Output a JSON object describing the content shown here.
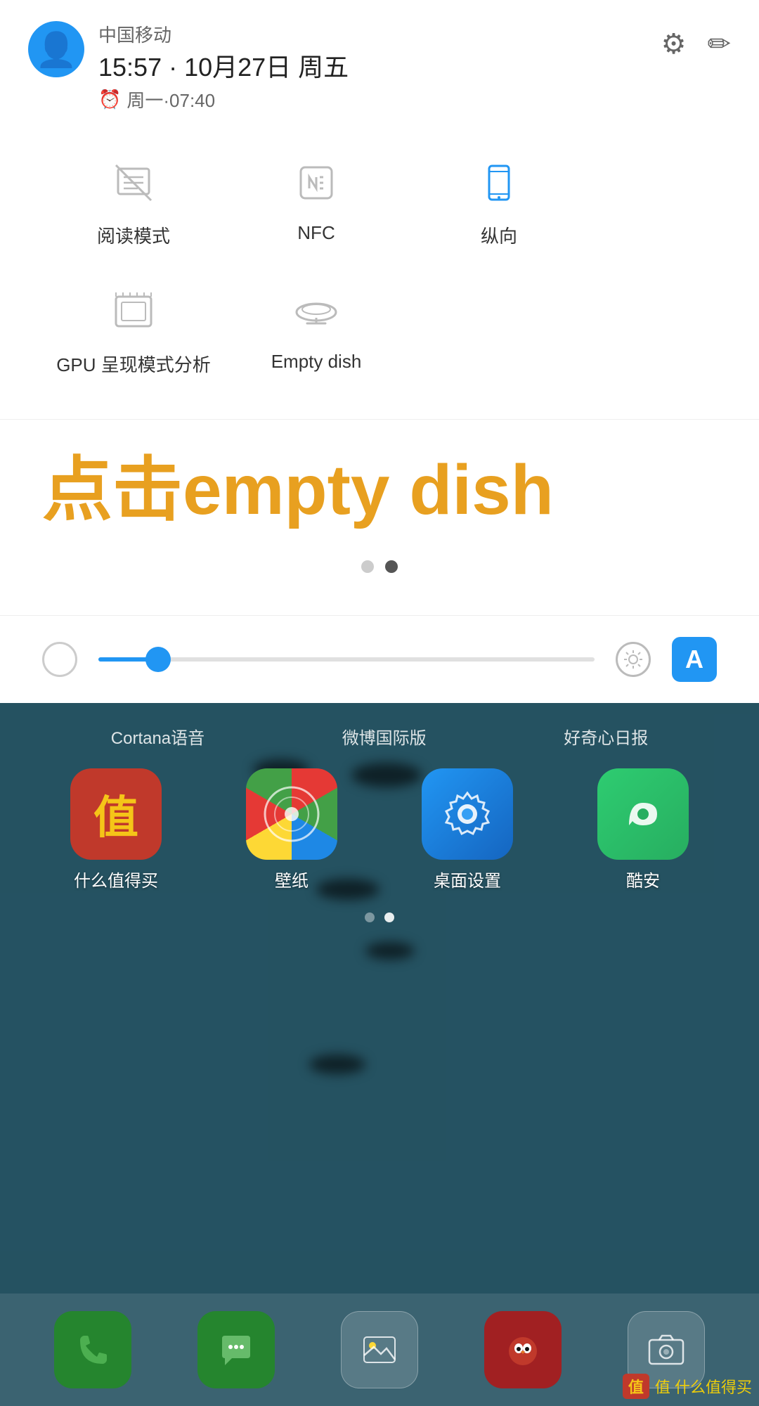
{
  "header": {
    "carrier": "中国移动",
    "datetime": "15:57 · 10月27日 周五",
    "alarm": "周一·07:40",
    "settings_label": "settings",
    "edit_label": "edit"
  },
  "quick_settings": {
    "row1": [
      {
        "id": "reading-mode",
        "label": "阅读模式",
        "state": "disabled",
        "icon": "book-slash"
      },
      {
        "id": "nfc",
        "label": "NFC",
        "state": "disabled",
        "icon": "nfc"
      },
      {
        "id": "orientation",
        "label": "纵向",
        "state": "active",
        "icon": "phone-portrait"
      }
    ],
    "row2": [
      {
        "id": "gpu-analysis",
        "label": "GPU 呈现模式分析",
        "state": "disabled",
        "icon": "gpu"
      },
      {
        "id": "empty-dish",
        "label": "Empty dish",
        "state": "disabled",
        "icon": "dish"
      }
    ]
  },
  "instruction": {
    "text": "点击empty dish"
  },
  "page_indicators": {
    "dots": [
      "inactive",
      "active"
    ]
  },
  "brightness": {
    "level": 12,
    "auto_label": "A"
  },
  "homescreen": {
    "top_app_labels": [
      "Cortana语音",
      "微博国际版",
      "好奇心日报"
    ],
    "apps": [
      {
        "name": "什么值得买",
        "icon": "zhide",
        "color": "#c0392b"
      },
      {
        "name": "壁纸",
        "icon": "cortana",
        "color": "#1e88d0"
      },
      {
        "name": "桌面设置",
        "icon": "settings",
        "color": "#2196F3"
      },
      {
        "name": "酷安",
        "icon": "kuan",
        "color": "#27ae60"
      }
    ],
    "dock_apps": [
      {
        "name": "phone",
        "icon": "📞",
        "color": "rgba(46,139,87,0.8)"
      },
      {
        "name": "message",
        "icon": "💬",
        "color": "rgba(46,139,87,0.8)"
      },
      {
        "name": "gallery",
        "icon": "🖼",
        "color": "rgba(255,255,255,0.2)"
      },
      {
        "name": "angry-birds",
        "icon": "😠",
        "color": "rgba(180,30,30,0.8)"
      },
      {
        "name": "camera",
        "icon": "📷",
        "color": "rgba(255,255,255,0.2)"
      }
    ],
    "page_dots": [
      "inactive",
      "active"
    ]
  },
  "watermark": {
    "text": "值 什么值得买"
  }
}
